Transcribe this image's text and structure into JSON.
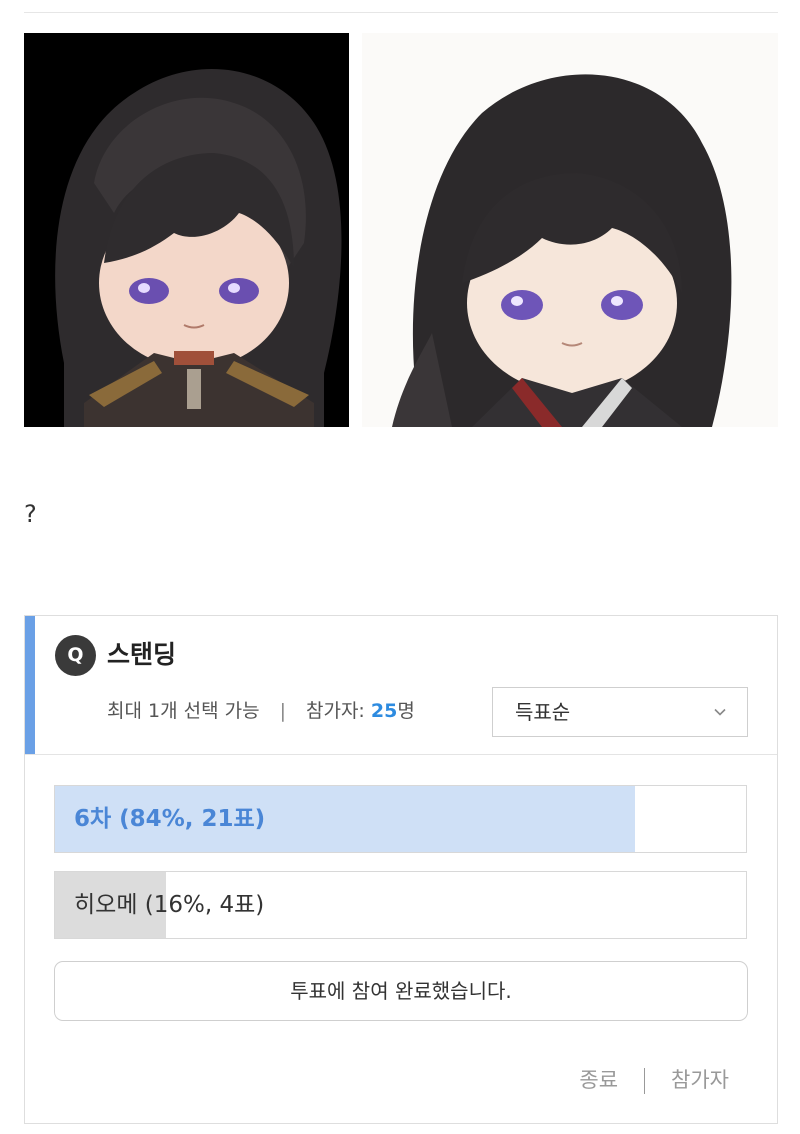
{
  "content": {
    "images": [
      {
        "icon": "character-portrait-left"
      },
      {
        "icon": "character-portrait-right"
      }
    ],
    "text": "?"
  },
  "poll": {
    "badge": "Q",
    "title": "스탠딩",
    "max_select": "최대 1개 선택 가능",
    "separator": "|",
    "participants_label": "참가자:",
    "participants_count": "25",
    "participants_unit": "명",
    "sort": {
      "selected": "득표순"
    },
    "options": [
      {
        "label": "6차 (84%, 21표)",
        "percent": 84,
        "votes": 21
      },
      {
        "label": "히오메 (16%, 4표)",
        "percent": 16,
        "votes": 4
      }
    ],
    "status_button": "투표에 참여 완료했습니다.",
    "footer": {
      "end_label": "종료",
      "participants_label": "참가자"
    }
  },
  "colors": {
    "accent": "#6aa0e6",
    "winner_fill": "#cfe0f6",
    "winner_text": "#4a86d6",
    "other_fill": "#dcdcdc",
    "count_blue": "#2d8be0"
  }
}
